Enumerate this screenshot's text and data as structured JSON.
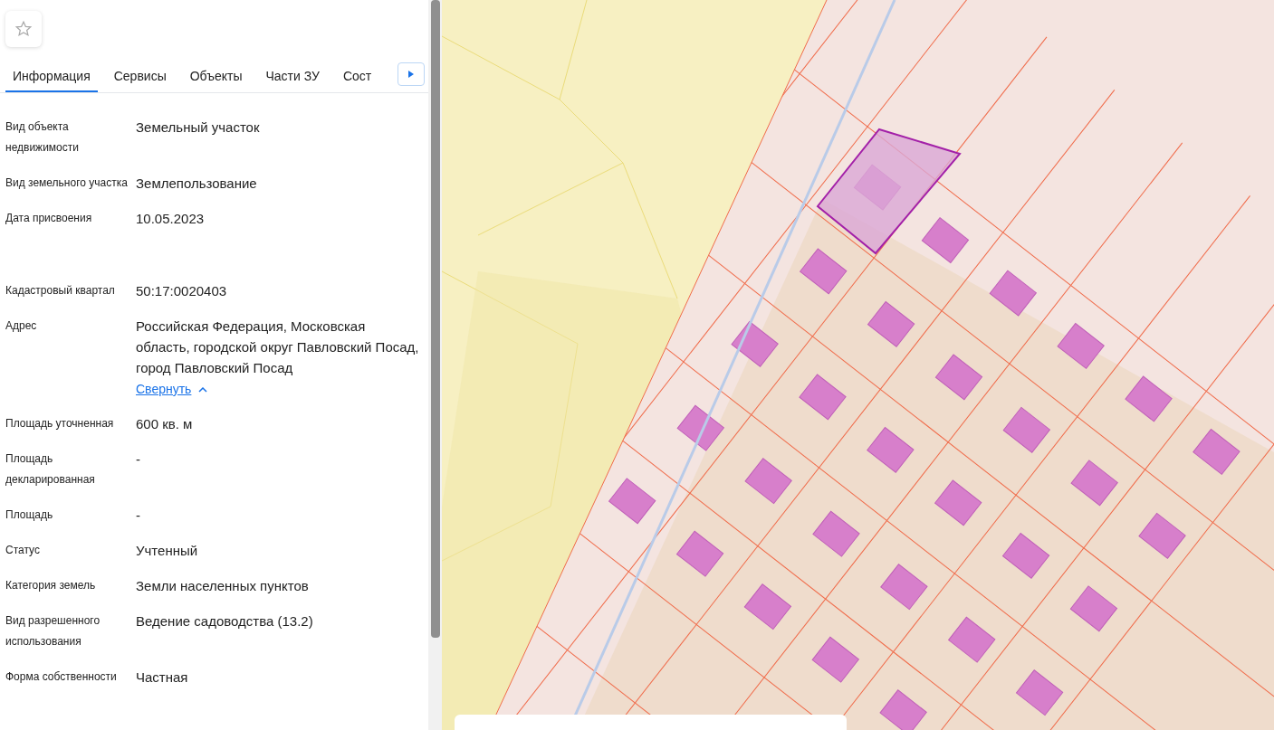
{
  "favorite": {
    "selected": false
  },
  "tabs": [
    {
      "label": "Информация",
      "selected": true
    },
    {
      "label": "Сервисы",
      "selected": false
    },
    {
      "label": "Объекты",
      "selected": false
    },
    {
      "label": "Части ЗУ",
      "selected": false
    },
    {
      "label": "Сост",
      "selected": false
    }
  ],
  "fields": [
    {
      "label": "Вид объекта недвижимости",
      "value": "Земельный участок"
    },
    {
      "label": "Вид земельного участка",
      "value": "Землепользование"
    },
    {
      "label": "Дата присвоения",
      "value": "10.05.2023"
    },
    {
      "label": "Кадастровый квартал",
      "value": "50:17:0020403"
    },
    {
      "label": "Адрес",
      "value": "Российская Федерация, Московская область, городской округ Павловский Посад, город Павловский Посад",
      "link": "Свернуть"
    },
    {
      "label": "Площадь уточненная",
      "value": "600 кв. м"
    },
    {
      "label": "Площадь декларированная",
      "value": "-"
    },
    {
      "label": "Площадь",
      "value": "-"
    },
    {
      "label": "Статус",
      "value": "Учтенный"
    },
    {
      "label": "Категория земель",
      "value": "Земли населенных пунктов"
    },
    {
      "label": "Вид разрешенного использования",
      "value": "Ведение садоводства (13.2)"
    },
    {
      "label": "Форма собственности",
      "value": "Частная"
    }
  ]
}
